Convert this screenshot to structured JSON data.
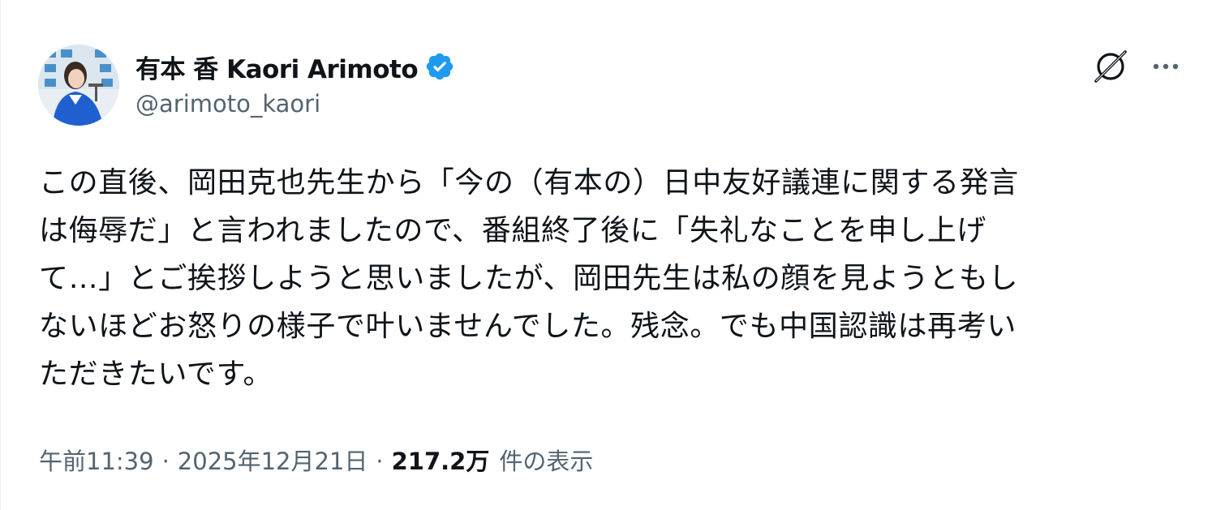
{
  "author": {
    "display_name": "有本 香 Kaori Arimoto",
    "handle": "@arimoto_kaori",
    "verified": true,
    "avatar_icon": "profile-photo"
  },
  "actions": {
    "grok_icon": "grok-icon",
    "more_icon": "more-options-icon"
  },
  "tweet": {
    "text_lines": [
      "この直後、岡田克也先生から「今の（有本の）日中友好議連に関する発言",
      "は侮辱だ」と言われましたので、番組終了後に「失礼なことを申し上げ",
      "て…」とご挨拶しようと思いましたが、岡田先生は私の顔を見ようともし",
      "ないほどお怒りの様子で叶いませんでした。残念。でも中国認識は再考い",
      "ただきたいです。"
    ]
  },
  "meta": {
    "time": "午前11:39",
    "separator": "·",
    "date": "2025年12月21日",
    "views_count": "217.2万",
    "views_label": "件の表示"
  },
  "colors": {
    "text_primary": "#0f1419",
    "text_secondary": "#536471",
    "verified_blue": "#1d9bf0"
  }
}
